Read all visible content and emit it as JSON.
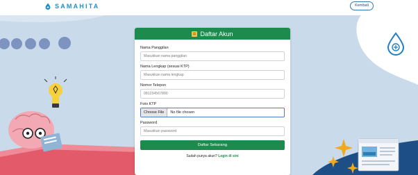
{
  "brand": {
    "name": "SAMAHITA"
  },
  "header": {
    "back_label": "Kembali"
  },
  "form": {
    "title": "Daftar Akun",
    "nickname": {
      "label": "Nama Panggilan",
      "placeholder": "Masukkan nama panggilan"
    },
    "fullname": {
      "label": "Nama Lengkap (sesuai KTP)",
      "placeholder": "Masukkan nama lengkap"
    },
    "phone": {
      "label": "Nomor Telepon",
      "placeholder": "081234567890"
    },
    "ktp": {
      "label": "Foto KTP",
      "button_label": "Choose File",
      "status": "No file chosen"
    },
    "password": {
      "label": "Password",
      "placeholder": "Masukkan password"
    },
    "submit_label": "Daftar Sekarang",
    "login_prompt": "Sudah punya akun?",
    "login_link": "Login di sini"
  },
  "colors": {
    "primary": "#1d8a4e",
    "brand": "#1f8fc7",
    "background": "#c9dbea"
  },
  "icons": [
    "water-drop-logo-icon",
    "form-icon",
    "water-drop-plus-icon",
    "lightbulb-icon",
    "brain-mascot-icon",
    "sparkle-icon",
    "document-illustration-icon"
  ]
}
